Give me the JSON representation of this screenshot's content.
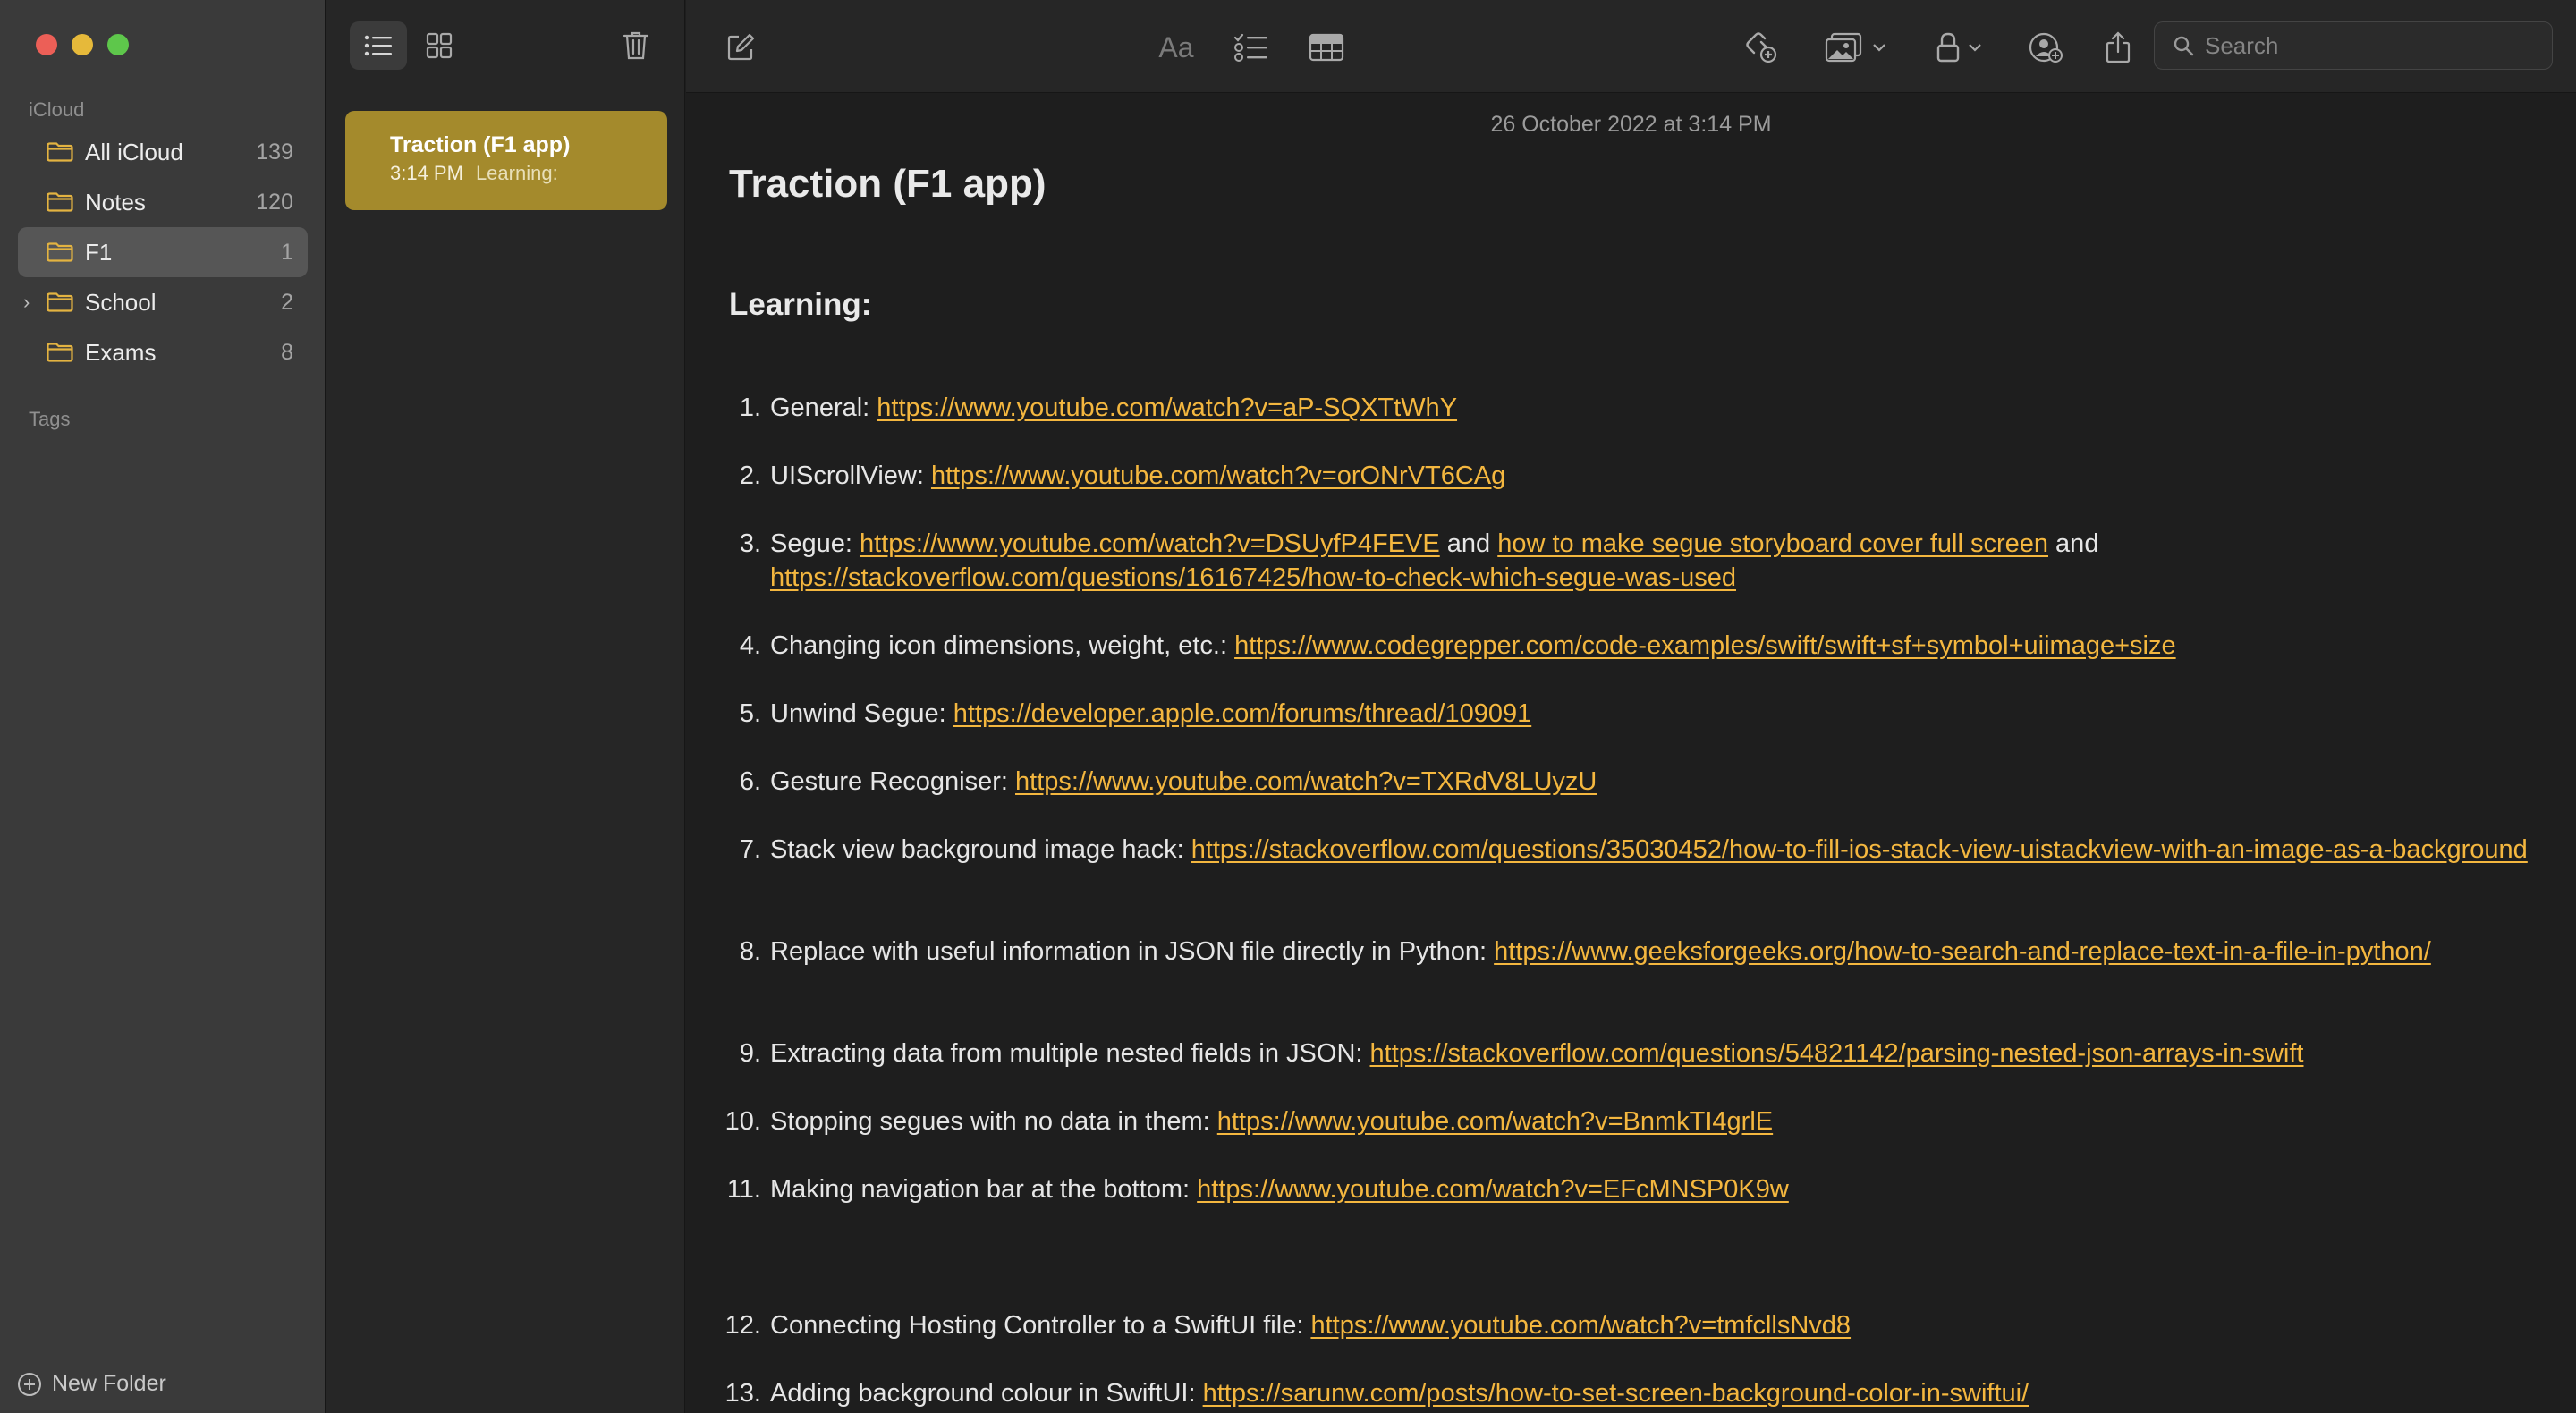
{
  "sidebar": {
    "section_icloud": "iCloud",
    "section_tags": "Tags",
    "new_folder_label": "New Folder",
    "folders": [
      {
        "name": "All iCloud",
        "count": "139"
      },
      {
        "name": "Notes",
        "count": "120"
      },
      {
        "name": "F1",
        "count": "1",
        "selected": true
      },
      {
        "name": "School",
        "count": "2",
        "expandable": true
      },
      {
        "name": "Exams",
        "count": "8"
      }
    ]
  },
  "notelist": {
    "notes": [
      {
        "title": "Traction (F1 app)",
        "time": "3:14 PM",
        "preview": "Learning:"
      }
    ]
  },
  "toolbar": {
    "search_placeholder": "Search",
    "icons": [
      "compose-icon",
      "format-text-icon",
      "checklist-icon",
      "table-icon",
      "collaborate-link-icon",
      "media-icon",
      "lock-icon",
      "share-people-icon",
      "share-icon"
    ]
  },
  "note": {
    "timestamp": "26 October 2022 at 3:14 PM",
    "title": "Traction (F1 app)",
    "heading": "Learning:",
    "items": [
      {
        "num": "1.",
        "segments": [
          {
            "text": "General: "
          },
          {
            "text": "https://www.youtube.com/watch?v=aP-SQXTtWhY",
            "link": true
          }
        ]
      },
      {
        "num": "2.",
        "segments": [
          {
            "text": "UIScrollView: "
          },
          {
            "text": "https://www.youtube.com/watch?v=orONrVT6CAg",
            "link": true
          }
        ]
      },
      {
        "num": "3.",
        "segments": [
          {
            "text": "Segue: "
          },
          {
            "text": "https://www.youtube.com/watch?v=DSUyfP4FEVE",
            "link": true
          },
          {
            "text": " and "
          },
          {
            "text": "how to make segue storyboard cover full screen",
            "link": true
          },
          {
            "text": " and "
          },
          {
            "text": "https://stackoverflow.com/questions/16167425/how-to-check-which-segue-was-used",
            "link": true
          }
        ]
      },
      {
        "num": "4.",
        "segments": [
          {
            "text": "Changing icon dimensions, weight, etc.: "
          },
          {
            "text": "https://www.codegrepper.com/code-examples/swift/swift+sf+symbol+uiimage+size",
            "link": true
          }
        ]
      },
      {
        "num": "5.",
        "segments": [
          {
            "text": "Unwind Segue: "
          },
          {
            "text": "https://developer.apple.com/forums/thread/109091",
            "link": true
          }
        ]
      },
      {
        "num": "6.",
        "segments": [
          {
            "text": "Gesture Recogniser: "
          },
          {
            "text": "https://www.youtube.com/watch?v=TXRdV8LUyzU",
            "link": true
          }
        ]
      },
      {
        "num": "7.",
        "segments": [
          {
            "text": "Stack view background image hack: "
          },
          {
            "text": "https://stackoverflow.com/questions/35030452/how-to-fill-ios-stack-view-uistackview-with-an-image-as-a-background",
            "link": true
          }
        ]
      },
      {
        "num": "8.",
        "segments": [
          {
            "text": "Replace with useful information in JSON file directly in Python: "
          },
          {
            "text": "https://www.geeksforgeeks.org/how-to-search-and-replace-text-in-a-file-in-python/",
            "link": true
          }
        ]
      },
      {
        "num": "9.",
        "segments": [
          {
            "text": "Extracting data from multiple nested fields in JSON: "
          },
          {
            "text": "https://stackoverflow.com/questions/54821142/parsing-nested-json-arrays-in-swift",
            "link": true
          }
        ]
      },
      {
        "num": "10.",
        "segments": [
          {
            "text": "Stopping segues with no data in them: "
          },
          {
            "text": "https://www.youtube.com/watch?v=BnmkTI4grlE",
            "link": true
          }
        ]
      },
      {
        "num": "11.",
        "segments": [
          {
            "text": "Making navigation bar at the bottom: "
          },
          {
            "text": "https://www.youtube.com/watch?v=EFcMNSP0K9w",
            "link": true
          }
        ]
      },
      {
        "num": "12.",
        "segments": [
          {
            "text": "Connecting Hosting Controller to a SwiftUI file: "
          },
          {
            "text": "https://www.youtube.com/watch?v=tmfcllsNvd8",
            "link": true
          }
        ]
      },
      {
        "num": "13.",
        "segments": [
          {
            "text": "Adding background colour in SwiftUI: "
          },
          {
            "text": "https://sarunw.com/posts/how-to-set-screen-background-color-in-swiftui/",
            "link": true
          }
        ]
      }
    ]
  },
  "colors": {
    "accent_link": "#f4b73f",
    "selected_note": "#a48a2c",
    "folder_icon": "#e3b341"
  }
}
